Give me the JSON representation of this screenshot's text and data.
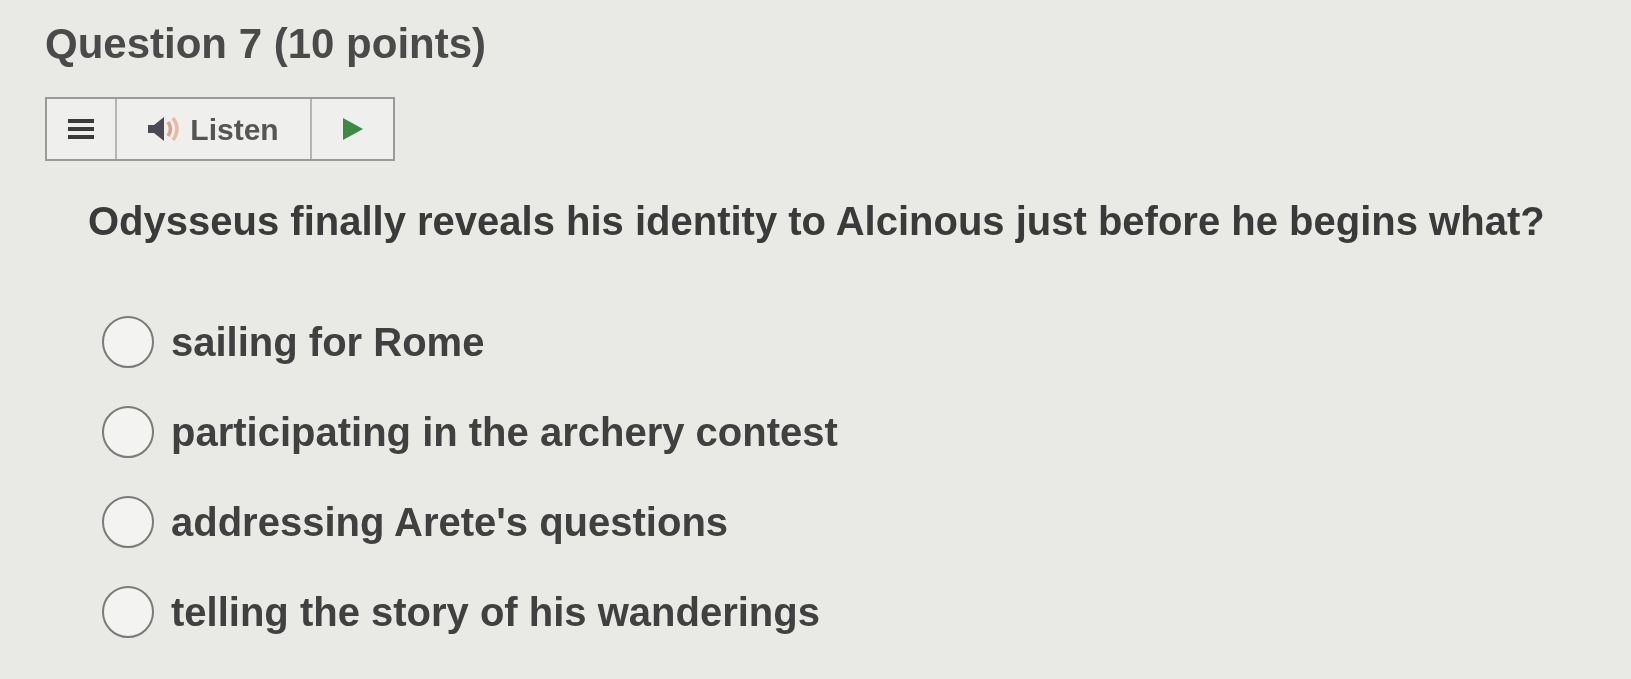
{
  "title": "Question 7 (10 points)",
  "toolbar": {
    "listen_label": "Listen"
  },
  "question": "Odysseus finally reveals his identity to Alcinous just before he begins what?",
  "options": [
    {
      "label": "sailing for Rome",
      "selected": false
    },
    {
      "label": "participating in the archery contest",
      "selected": false
    },
    {
      "label": "addressing Arete's questions",
      "selected": false
    },
    {
      "label": "telling the story of his wanderings",
      "selected": false
    }
  ]
}
